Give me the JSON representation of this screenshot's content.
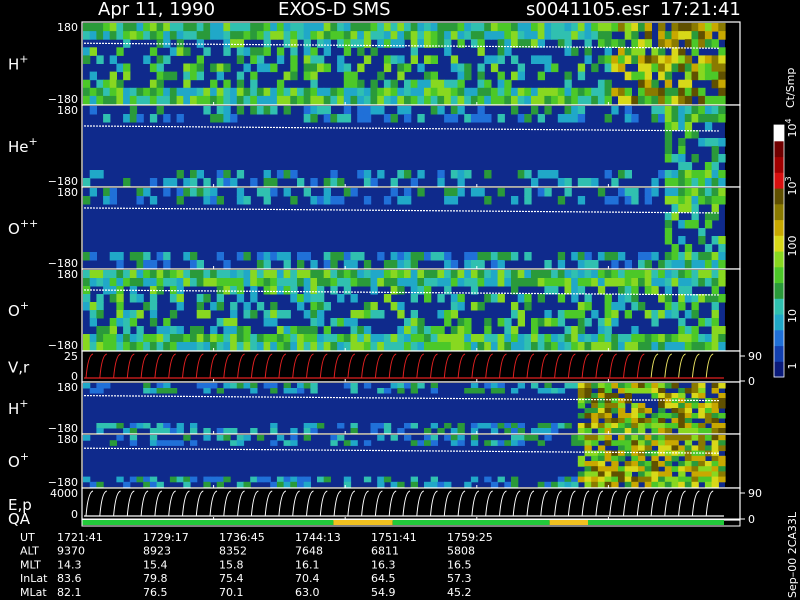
{
  "header": {
    "date": "Apr 11, 1990",
    "instrument": "EXOS-D SMS",
    "file": "s0041105.esr",
    "time": "17:21:41"
  },
  "chart_data": {
    "type": "heatmap",
    "title": "Apr 11, 1990   EXOS-D SMS",
    "panels": [
      {
        "id": "hplus",
        "label": "H",
        "sup": "+",
        "ylim": [
          -180,
          180
        ],
        "ticks": [
          "180",
          "−180"
        ],
        "kind": "spectrogram",
        "bands": [
          {
            "t": [
              1721.68,
              1752.0
            ],
            "intensity": "low-mid (10–100)"
          },
          {
            "t": [
              1752.0,
              1758.5
            ],
            "intensity": "high (100–1000)"
          }
        ]
      },
      {
        "id": "heplus",
        "label": "He",
        "sup": "+",
        "ylim": [
          -180,
          180
        ],
        "ticks": [
          "180",
          "−180"
        ],
        "kind": "spectrogram",
        "bands": [
          {
            "t": [
              1721.68,
              1755.0
            ],
            "intensity": "low (1–10)"
          },
          {
            "t": [
              1755.0,
              1758.5
            ],
            "intensity": "mid (10–100)"
          }
        ]
      },
      {
        "id": "oplusplus",
        "label": "O",
        "sup": "++",
        "ylim": [
          -180,
          180
        ],
        "ticks": [
          "180",
          "−180"
        ],
        "kind": "spectrogram",
        "bands": [
          {
            "t": [
              1721.68,
              1755.0
            ],
            "intensity": "low (1–10)"
          },
          {
            "t": [
              1755.0,
              1758.5
            ],
            "intensity": "mid (10–100)"
          }
        ]
      },
      {
        "id": "oplus",
        "label": "O",
        "sup": "+",
        "ylim": [
          -180,
          180
        ],
        "ticks": [
          "180",
          "−180"
        ],
        "kind": "spectrogram",
        "bands": [
          {
            "t": [
              1721.68,
              1755.0
            ],
            "intensity": "low-mid (10–100)"
          },
          {
            "t": [
              1755.0,
              1758.5
            ],
            "intensity": "mid (10–100)"
          }
        ]
      },
      {
        "id": "vr",
        "label": "V,r",
        "ylim": [
          0,
          25
        ],
        "ticks": [
          "25",
          "0"
        ],
        "right_ticks": [
          "90",
          "0"
        ],
        "kind": "line"
      },
      {
        "id": "hplus2",
        "label": "H",
        "sup": "+",
        "ylim": [
          -180,
          180
        ],
        "ticks": [
          "180",
          "−180"
        ],
        "kind": "spectrogram",
        "bands": [
          {
            "t": [
              1721.68,
              1750.0
            ],
            "intensity": "low (1–10)"
          },
          {
            "t": [
              1750.0,
              1758.5
            ],
            "intensity": "mid-high (10–1000)"
          }
        ]
      },
      {
        "id": "oplus2",
        "label": "O",
        "sup": "+",
        "ylim": [
          -180,
          180
        ],
        "ticks": [
          "180",
          "−180"
        ],
        "kind": "spectrogram",
        "bands": [
          {
            "t": [
              1721.68,
              1750.0
            ],
            "intensity": "low (1–10)"
          },
          {
            "t": [
              1750.0,
              1758.5
            ],
            "intensity": "mid-high (10–1000)"
          }
        ]
      },
      {
        "id": "ep",
        "label": "E,p",
        "ylim": [
          0,
          4000
        ],
        "ticks": [
          "4000",
          "0"
        ],
        "right_ticks": [
          "90",
          "0"
        ],
        "kind": "line"
      }
    ],
    "qa": {
      "label": "QA",
      "segments": [
        {
          "start": 1721.68,
          "end": 1736.1,
          "quality": "good",
          "color": "#22c93a"
        },
        {
          "start": 1736.1,
          "end": 1739.5,
          "quality": "fair",
          "color": "#f0c020"
        },
        {
          "start": 1739.5,
          "end": 1748.5,
          "quality": "good",
          "color": "#22c93a"
        },
        {
          "start": 1748.5,
          "end": 1750.7,
          "quality": "fair",
          "color": "#f0c020"
        },
        {
          "start": 1750.7,
          "end": 1758.5,
          "quality": "good",
          "color": "#22c93a"
        }
      ]
    },
    "x_axis_ticks": [
      "1721:41",
      "1729:17",
      "1736:45",
      "1744:13",
      "1751:41",
      "1759:25"
    ],
    "xlim_minutes": [
      1721.68,
      1759.42
    ],
    "data_end_minutes": 1758.5,
    "ephemeris": [
      {
        "label": "UT",
        "values": [
          "1721:41",
          "1729:17",
          "1736:45",
          "1744:13",
          "1751:41",
          "1759:25"
        ]
      },
      {
        "label": "ALT",
        "values": [
          "9370",
          "8923",
          "8352",
          "7648",
          "6811",
          "5808"
        ]
      },
      {
        "label": "MLT",
        "values": [
          "14.3",
          "15.4",
          "15.8",
          "16.1",
          "16.3",
          "16.5"
        ]
      },
      {
        "label": "InLat",
        "values": [
          "83.6",
          "79.8",
          "75.4",
          "70.4",
          "64.5",
          "57.3"
        ]
      },
      {
        "label": "MLat",
        "values": [
          "82.1",
          "76.5",
          "70.1",
          "63.0",
          "54.9",
          "45.2"
        ]
      }
    ],
    "colorbar": {
      "unit": "Ct/Smp",
      "scale": "log",
      "range": [
        1,
        10000
      ],
      "tick_labels": [
        "1",
        "10",
        "100",
        "10",
        "10"
      ],
      "tick_exponents": [
        "",
        "",
        "",
        "3",
        "4"
      ],
      "colors": [
        "#0a1a7a",
        "#1240b0",
        "#2070d8",
        "#20a8c8",
        "#30c0b0",
        "#2a9a3a",
        "#4cc828",
        "#88d820",
        "#d8d818",
        "#c8a800",
        "#8a7a00",
        "#605000",
        "#d81010",
        "#a00000",
        "#700000",
        "#ffffff"
      ]
    },
    "footer_note": "Sep–00  2CA33L"
  }
}
